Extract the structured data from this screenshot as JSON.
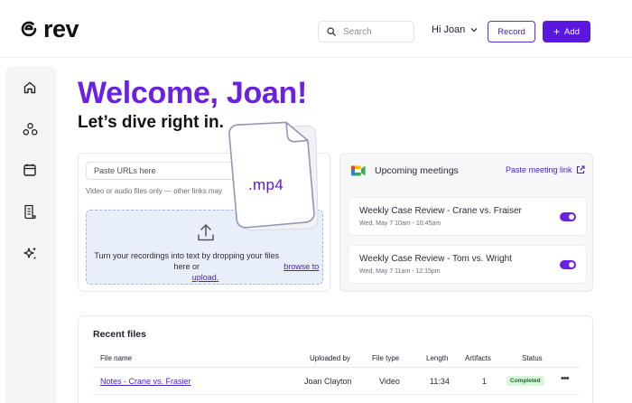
{
  "header": {
    "logo_text": "rev",
    "search_placeholder": "Search",
    "user_greeting": "Hi Joan",
    "record_label": "Record",
    "add_label": "Add",
    "accent_color": "#5a17e0"
  },
  "sidebar": {
    "items": [
      {
        "icon": "home-icon"
      },
      {
        "icon": "groups-icon"
      },
      {
        "icon": "calendar-icon"
      },
      {
        "icon": "document-icon"
      },
      {
        "icon": "sparkle-icon"
      }
    ]
  },
  "main": {
    "welcome": "Welcome, Joan!",
    "subtitle": "Let’s dive right in.",
    "upload": {
      "url_placeholder": "Paste URLs here",
      "url_hint": "Video or audio files only — other links may",
      "drop_text": "Turn your recordings into text by dropping your files here or",
      "drop_link": "browse to upload.",
      "file_label": ".mp4"
    },
    "meetings": {
      "title": "Upcoming meetings",
      "paste_link": "Paste meeting link",
      "items": [
        {
          "name": "Weekly Case Review - Crane vs. Fraiser",
          "time": "Wed, May 7 10am - 10:45am",
          "enabled": true
        },
        {
          "name": "Weekly Case Review - Tom vs. Wright",
          "time": "Wed, May 7 11am - 12:15pm",
          "enabled": true
        }
      ]
    },
    "recent_files": {
      "title": "Recent files",
      "columns": [
        "File name",
        "Uploaded by",
        "File type",
        "Length",
        "Artifacts",
        "Status"
      ],
      "rows": [
        {
          "file_name": "Notes - Crane vs. Frasier",
          "uploaded_by": "Joan Clayton",
          "file_type": "Video",
          "length": "11:34",
          "artifacts": "1",
          "status": "Completed"
        }
      ]
    }
  }
}
